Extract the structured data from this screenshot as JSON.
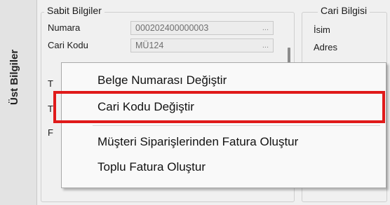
{
  "side_tab": {
    "label": "Üst Bilgiler"
  },
  "sabit": {
    "title": "Sabit Bilgiler",
    "fields": [
      {
        "label": "Numara",
        "value": "000202400000003",
        "button": "..."
      },
      {
        "label": "Cari Kodu",
        "value": "MÜ124",
        "button": "..."
      }
    ],
    "partial_labels": [
      "T",
      "T",
      "F"
    ]
  },
  "cari": {
    "title": "Cari Bilgisi",
    "fields": [
      {
        "label": "İsim"
      },
      {
        "label": "Adres"
      }
    ]
  },
  "context_menu": {
    "items": [
      {
        "label": "Belge Numarası Değiştir"
      },
      {
        "label": "Cari Kodu Değiştir",
        "highlighted": true
      },
      {
        "label": "Müşteri Siparişlerinden Fatura Oluştur"
      },
      {
        "label": "Toplu Fatura Oluştur"
      }
    ]
  },
  "colors": {
    "highlight": "#e01a1a",
    "background": "#f0f0f0",
    "menu_background": "#f9f9f9"
  }
}
